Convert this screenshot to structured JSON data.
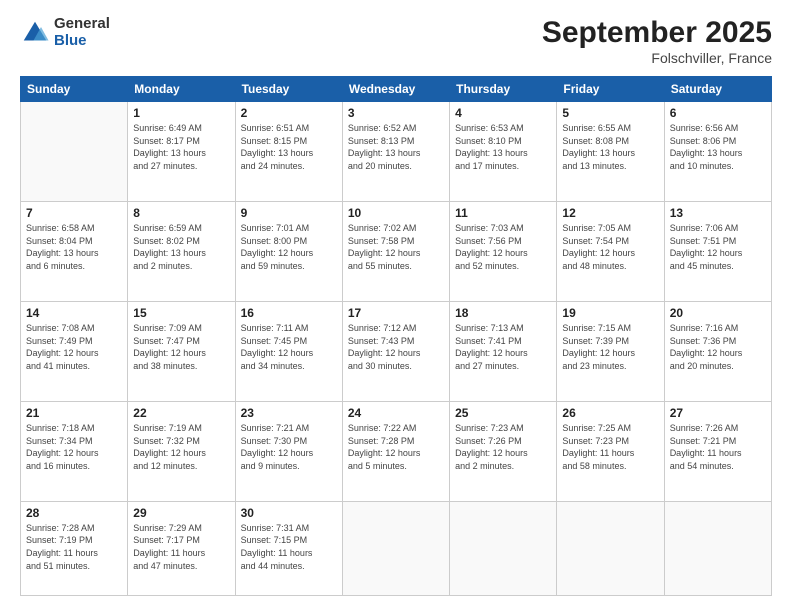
{
  "logo": {
    "general": "General",
    "blue": "Blue"
  },
  "title": "September 2025",
  "location": "Folschviller, France",
  "days_header": [
    "Sunday",
    "Monday",
    "Tuesday",
    "Wednesday",
    "Thursday",
    "Friday",
    "Saturday"
  ],
  "weeks": [
    [
      {
        "day": "",
        "info": ""
      },
      {
        "day": "1",
        "info": "Sunrise: 6:49 AM\nSunset: 8:17 PM\nDaylight: 13 hours\nand 27 minutes."
      },
      {
        "day": "2",
        "info": "Sunrise: 6:51 AM\nSunset: 8:15 PM\nDaylight: 13 hours\nand 24 minutes."
      },
      {
        "day": "3",
        "info": "Sunrise: 6:52 AM\nSunset: 8:13 PM\nDaylight: 13 hours\nand 20 minutes."
      },
      {
        "day": "4",
        "info": "Sunrise: 6:53 AM\nSunset: 8:10 PM\nDaylight: 13 hours\nand 17 minutes."
      },
      {
        "day": "5",
        "info": "Sunrise: 6:55 AM\nSunset: 8:08 PM\nDaylight: 13 hours\nand 13 minutes."
      },
      {
        "day": "6",
        "info": "Sunrise: 6:56 AM\nSunset: 8:06 PM\nDaylight: 13 hours\nand 10 minutes."
      }
    ],
    [
      {
        "day": "7",
        "info": "Sunrise: 6:58 AM\nSunset: 8:04 PM\nDaylight: 13 hours\nand 6 minutes."
      },
      {
        "day": "8",
        "info": "Sunrise: 6:59 AM\nSunset: 8:02 PM\nDaylight: 13 hours\nand 2 minutes."
      },
      {
        "day": "9",
        "info": "Sunrise: 7:01 AM\nSunset: 8:00 PM\nDaylight: 12 hours\nand 59 minutes."
      },
      {
        "day": "10",
        "info": "Sunrise: 7:02 AM\nSunset: 7:58 PM\nDaylight: 12 hours\nand 55 minutes."
      },
      {
        "day": "11",
        "info": "Sunrise: 7:03 AM\nSunset: 7:56 PM\nDaylight: 12 hours\nand 52 minutes."
      },
      {
        "day": "12",
        "info": "Sunrise: 7:05 AM\nSunset: 7:54 PM\nDaylight: 12 hours\nand 48 minutes."
      },
      {
        "day": "13",
        "info": "Sunrise: 7:06 AM\nSunset: 7:51 PM\nDaylight: 12 hours\nand 45 minutes."
      }
    ],
    [
      {
        "day": "14",
        "info": "Sunrise: 7:08 AM\nSunset: 7:49 PM\nDaylight: 12 hours\nand 41 minutes."
      },
      {
        "day": "15",
        "info": "Sunrise: 7:09 AM\nSunset: 7:47 PM\nDaylight: 12 hours\nand 38 minutes."
      },
      {
        "day": "16",
        "info": "Sunrise: 7:11 AM\nSunset: 7:45 PM\nDaylight: 12 hours\nand 34 minutes."
      },
      {
        "day": "17",
        "info": "Sunrise: 7:12 AM\nSunset: 7:43 PM\nDaylight: 12 hours\nand 30 minutes."
      },
      {
        "day": "18",
        "info": "Sunrise: 7:13 AM\nSunset: 7:41 PM\nDaylight: 12 hours\nand 27 minutes."
      },
      {
        "day": "19",
        "info": "Sunrise: 7:15 AM\nSunset: 7:39 PM\nDaylight: 12 hours\nand 23 minutes."
      },
      {
        "day": "20",
        "info": "Sunrise: 7:16 AM\nSunset: 7:36 PM\nDaylight: 12 hours\nand 20 minutes."
      }
    ],
    [
      {
        "day": "21",
        "info": "Sunrise: 7:18 AM\nSunset: 7:34 PM\nDaylight: 12 hours\nand 16 minutes."
      },
      {
        "day": "22",
        "info": "Sunrise: 7:19 AM\nSunset: 7:32 PM\nDaylight: 12 hours\nand 12 minutes."
      },
      {
        "day": "23",
        "info": "Sunrise: 7:21 AM\nSunset: 7:30 PM\nDaylight: 12 hours\nand 9 minutes."
      },
      {
        "day": "24",
        "info": "Sunrise: 7:22 AM\nSunset: 7:28 PM\nDaylight: 12 hours\nand 5 minutes."
      },
      {
        "day": "25",
        "info": "Sunrise: 7:23 AM\nSunset: 7:26 PM\nDaylight: 12 hours\nand 2 minutes."
      },
      {
        "day": "26",
        "info": "Sunrise: 7:25 AM\nSunset: 7:23 PM\nDaylight: 11 hours\nand 58 minutes."
      },
      {
        "day": "27",
        "info": "Sunrise: 7:26 AM\nSunset: 7:21 PM\nDaylight: 11 hours\nand 54 minutes."
      }
    ],
    [
      {
        "day": "28",
        "info": "Sunrise: 7:28 AM\nSunset: 7:19 PM\nDaylight: 11 hours\nand 51 minutes."
      },
      {
        "day": "29",
        "info": "Sunrise: 7:29 AM\nSunset: 7:17 PM\nDaylight: 11 hours\nand 47 minutes."
      },
      {
        "day": "30",
        "info": "Sunrise: 7:31 AM\nSunset: 7:15 PM\nDaylight: 11 hours\nand 44 minutes."
      },
      {
        "day": "",
        "info": ""
      },
      {
        "day": "",
        "info": ""
      },
      {
        "day": "",
        "info": ""
      },
      {
        "day": "",
        "info": ""
      }
    ]
  ]
}
